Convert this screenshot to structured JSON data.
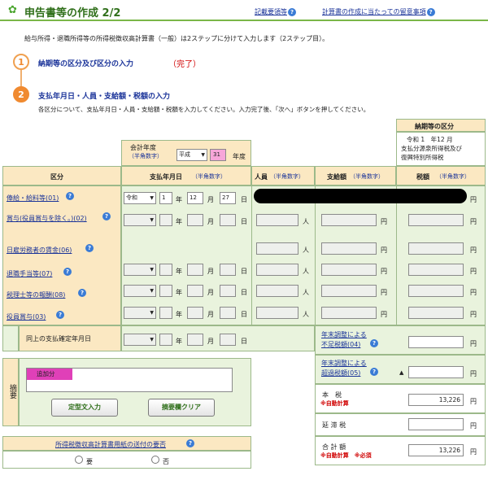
{
  "header": {
    "title": "申告書等の作成 2/2",
    "link1": "記載要領等",
    "link2": "計算書の作成に当たっての留意事項"
  },
  "intro": "給与所得・退職所得等の所得税徴収高計算書（一般）は2ステップに分けて入力します（2ステップ目）。",
  "step1": {
    "num": "1",
    "title": "納期等の区分及び区分の入力",
    "status": "（完了）"
  },
  "step2": {
    "num": "2",
    "title": "支払年月日・人員・支給額・税額の入力",
    "desc": "各区分について、支払年月日・人員・支給額・税額を入力してください。入力完了後、「次へ」ボタンを押してください。"
  },
  "fiscal": {
    "label": "会計年度",
    "sub": "（半角数字）",
    "era": "平成",
    "year": "31",
    "unit": "年度"
  },
  "noki": {
    "head": "納期等の区分",
    "line1": "令和 1　年12 月",
    "line2": "支払分源泉所得税及び",
    "line3": "復興特別所得税"
  },
  "cols": {
    "kubun": "区分",
    "date": "支払年月日",
    "date_sub": "（半角数字）",
    "jin": "人員",
    "jin_sub": "（半角数字）",
    "shi": "支給額",
    "shi_sub": "（半角数字）",
    "zei": "税額",
    "zei_sub": "（半角数字）"
  },
  "units": {
    "nen": "年",
    "tsuki": "月",
    "hi": "日",
    "nin": "人",
    "en": "円"
  },
  "rows": [
    {
      "label": "俸給・給料等(01)",
      "era": "令和",
      "y": "1",
      "m": "12",
      "d": "27"
    },
    {
      "label": "賞与(役員賞与を除く。)(02)",
      "era": "",
      "y": "",
      "m": "",
      "d": ""
    },
    {
      "label": "日雇労務者の賃金(06)",
      "era": "",
      "y": "",
      "m": "",
      "d": ""
    },
    {
      "label": "退職手当等(07)",
      "era": "",
      "y": "",
      "m": "",
      "d": ""
    },
    {
      "label": "税理士等の報酬(08)",
      "era": "",
      "y": "",
      "m": "",
      "d": ""
    },
    {
      "label": "役員賞与(03)",
      "era": "",
      "y": "",
      "m": "",
      "d": ""
    },
    {
      "label": "同上の支払確定年月日",
      "era": "",
      "y": "",
      "m": "",
      "d": ""
    }
  ],
  "right": {
    "fusoku1": "年末調整による",
    "fusoku2": "不足税額(04)",
    "kakou1": "年末調整による",
    "kakou2": "超過税額(05)",
    "honzei": "本　税",
    "auto": "※自動計算",
    "honzei_value": "13,226",
    "entai": "延 滞 税",
    "gokei": "合 計 額",
    "auto2": "※自動計算　※必須",
    "gokei_value": "13,226",
    "triangle": "▲"
  },
  "tekiyo": {
    "label": "摘要",
    "tag": "追加分",
    "btn1": "定型文入力",
    "btn2": "摘要欄クリア"
  },
  "send": {
    "title": "所得税徴収高計算書用紙の送付の要否",
    "yes": "要",
    "no": "否"
  }
}
